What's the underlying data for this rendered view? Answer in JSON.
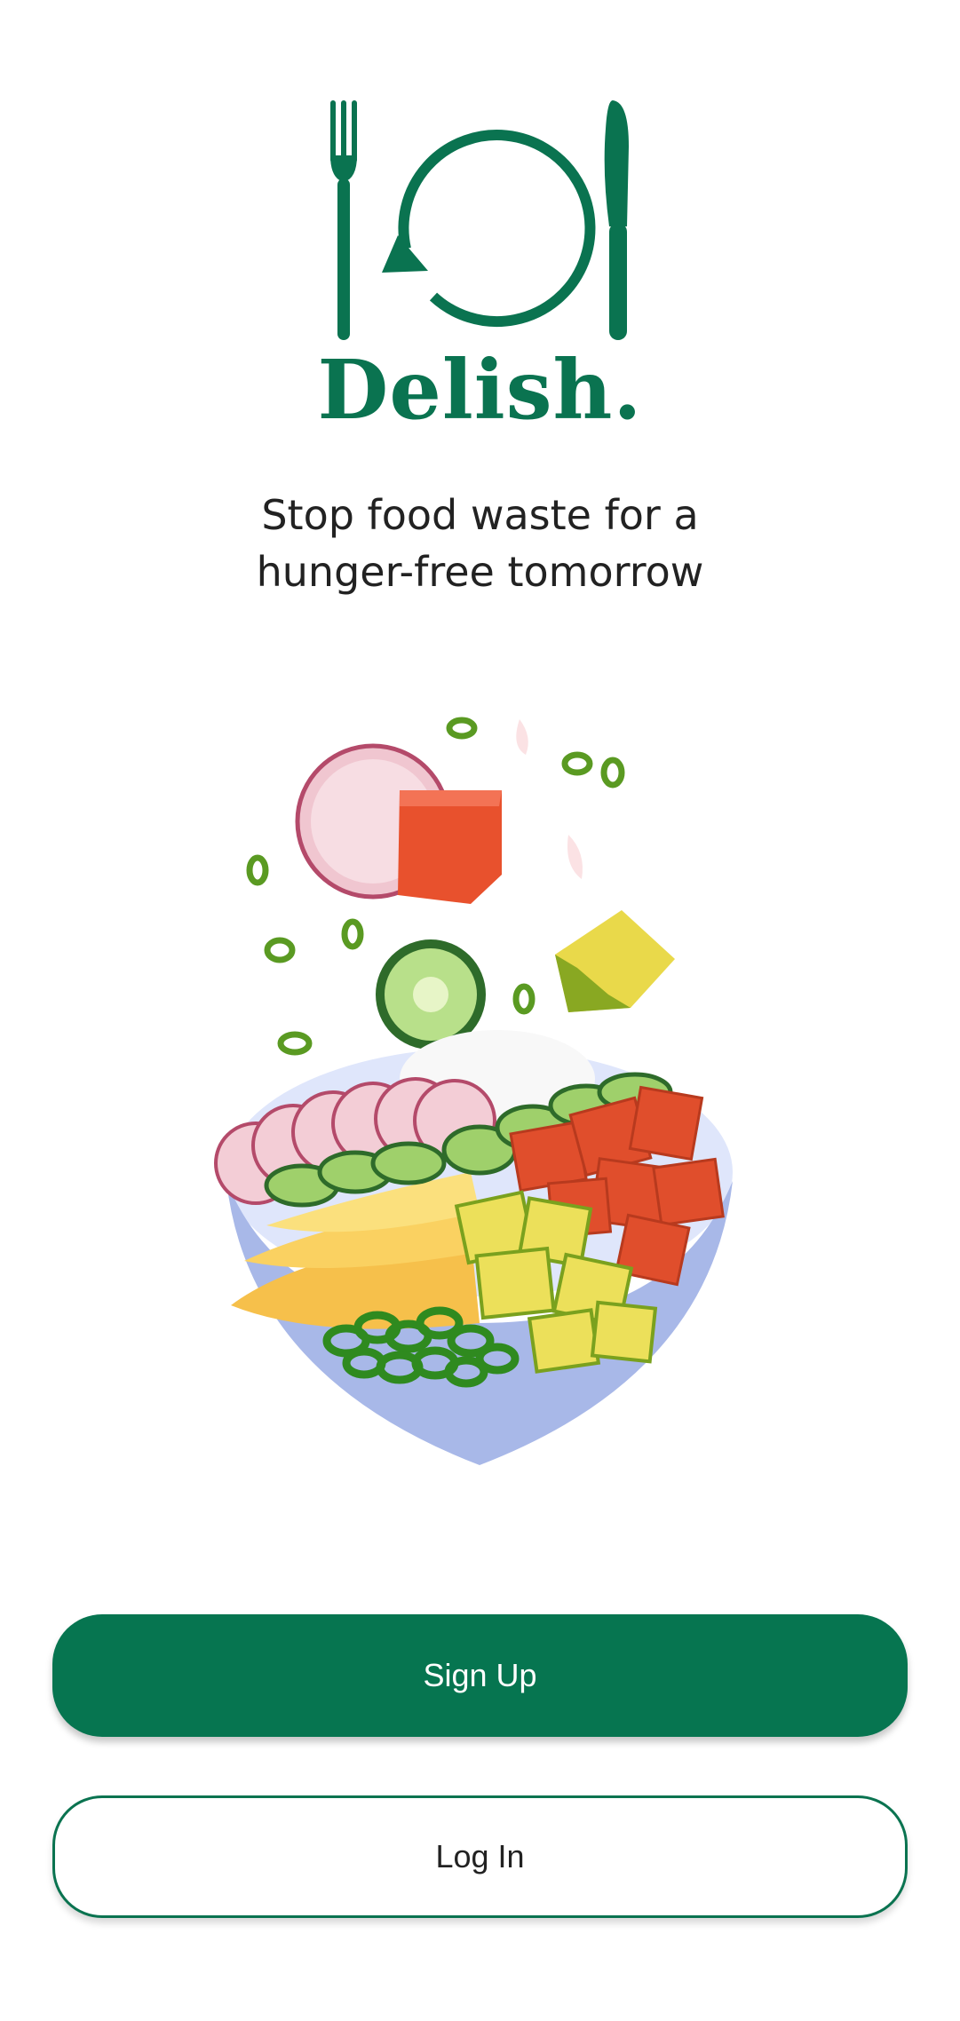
{
  "brand": {
    "name": "Delish.",
    "color": "#0a7350"
  },
  "tagline": {
    "line1": "Stop food waste for a",
    "line2": "hunger-free tomorrow"
  },
  "illustration": {
    "icon": "poke-bowl-illustration"
  },
  "actions": {
    "signup_label": "Sign Up",
    "login_label": "Log In"
  },
  "colors": {
    "primary": "#067550",
    "text": "#222222",
    "background": "#ffffff"
  }
}
